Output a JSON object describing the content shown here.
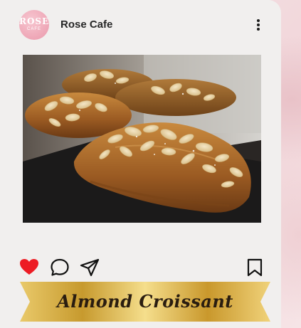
{
  "profile": {
    "username": "Rose Cafe",
    "avatar_logo_text": "ROSE",
    "avatar_logo_subtext": "CAFE"
  },
  "icons": {
    "more": "more-vertical-icon",
    "like": "heart-icon",
    "comment": "comment-bubble-icon",
    "share": "paper-plane-icon",
    "save": "bookmark-icon"
  },
  "post": {
    "liked": true,
    "caption_title": "Almond Croissant"
  },
  "colors": {
    "like_red": "#ed1c24",
    "card_bg": "#f1efee",
    "banner_gold": "#e6c35c"
  }
}
